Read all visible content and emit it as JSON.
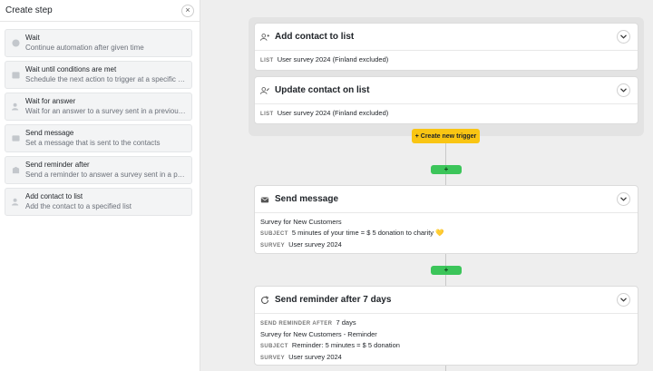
{
  "panel": {
    "title": "Create step",
    "close_glyph": "×",
    "steps": [
      {
        "name": "Wait",
        "desc": "Continue automation after given time",
        "icon": "clock-icon"
      },
      {
        "name": "Wait until conditions are met",
        "desc": "Schedule the next action to trigger at a specific ti...",
        "icon": "calendar-icon"
      },
      {
        "name": "Wait for answer",
        "desc": "Wait for an answer to a survey sent in a previous s...",
        "icon": "user-wait-icon"
      },
      {
        "name": "Send message",
        "desc": "Set a message that is sent to the contacts",
        "icon": "mail-icon"
      },
      {
        "name": "Send reminder after",
        "desc": "Send a reminder to answer a survey sent in a previ...",
        "icon": "reminder-icon"
      },
      {
        "name": "Add contact to list",
        "desc": "Add the contact to a specified list",
        "icon": "user-add-icon"
      }
    ]
  },
  "canvas": {
    "create_trigger_label": "+ Create new trigger",
    "add_label": "+",
    "cards": {
      "add_contact": {
        "title": "Add contact to list",
        "list_label": "LIST",
        "list_value": "User survey 2024 (Finland excluded)"
      },
      "update_contact": {
        "title": "Update contact on list",
        "list_label": "LIST",
        "list_value": "User survey 2024 (Finland excluded)"
      },
      "send_message": {
        "title": "Send message",
        "line1": "Survey for New Customers",
        "subject_label": "SUBJECT",
        "subject_value": "5 minutes of your time = $ 5 donation to charity",
        "subject_emoji": "💛",
        "survey_label": "SURVEY",
        "survey_value": "User survey 2024"
      },
      "send_reminder": {
        "title": "Send reminder after 7 days",
        "after_label": "SEND REMINDER AFTER",
        "after_value": "7 days",
        "line1": "Survey for New Customers - Reminder",
        "subject_label": "SUBJECT",
        "subject_value": "Reminder: 5 minutes = $ 5 donation",
        "survey_label": "SURVEY",
        "survey_value": "User survey 2024"
      }
    }
  }
}
